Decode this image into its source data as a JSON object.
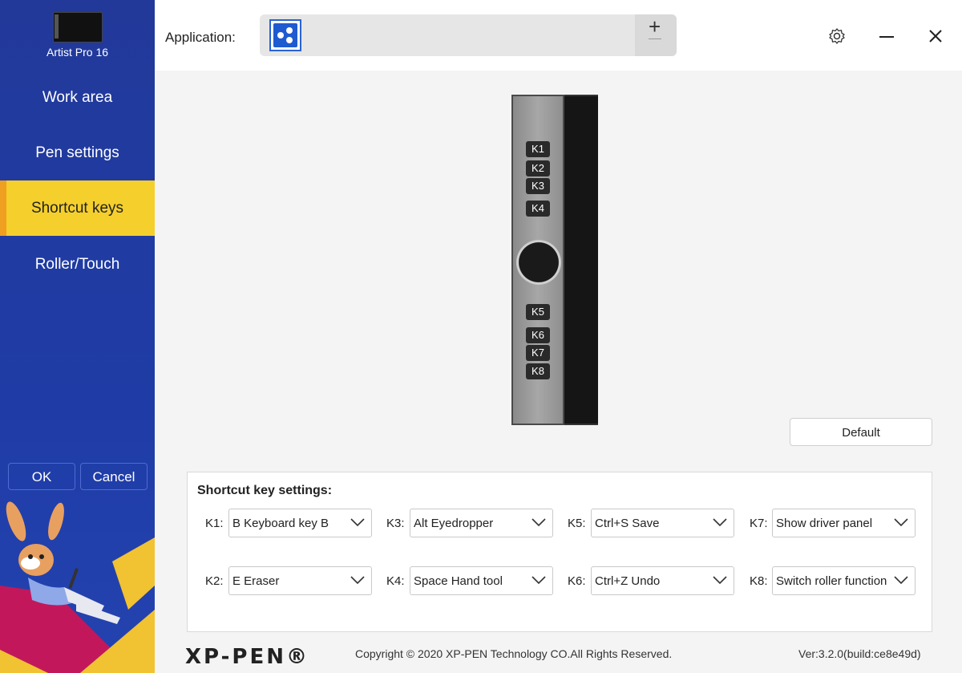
{
  "sidebar": {
    "device_name": "Artist Pro 16",
    "items": [
      {
        "label": "Work area"
      },
      {
        "label": "Pen settings"
      },
      {
        "label": "Shortcut keys"
      },
      {
        "label": "Roller/Touch"
      }
    ],
    "active": "Shortcut keys",
    "ok_label": "OK",
    "cancel_label": "Cancel"
  },
  "header": {
    "application_label": "Application:",
    "add_label": "+"
  },
  "device": {
    "keys": [
      "K1",
      "K2",
      "K3",
      "K4",
      "K5",
      "K6",
      "K7",
      "K8"
    ]
  },
  "default_label": "Default",
  "shortcuts": {
    "title": "Shortcut key settings:",
    "k1": {
      "label": "K1:",
      "value": "B Keyboard key B"
    },
    "k2": {
      "label": "K2:",
      "value": "E Eraser"
    },
    "k3": {
      "label": "K3:",
      "value": "Alt Eyedropper"
    },
    "k4": {
      "label": "K4:",
      "value": "Space Hand tool"
    },
    "k5": {
      "label": "K5:",
      "value": "Ctrl+S Save"
    },
    "k6": {
      "label": "K6:",
      "value": "Ctrl+Z Undo"
    },
    "k7": {
      "label": "K7:",
      "value": "Show driver panel"
    },
    "k8": {
      "label": "K8:",
      "value": "Switch roller function"
    }
  },
  "footer": {
    "logo": "XP-PEN®",
    "copyright": "Copyright © 2020 XP-PEN Technology CO.All Rights Reserved.",
    "version": "Ver:3.2.0(build:ce8e49d)"
  },
  "colors": {
    "sidebar": "#22399a",
    "active_item": "#f5cf2c",
    "accent": "#2a63d3"
  }
}
